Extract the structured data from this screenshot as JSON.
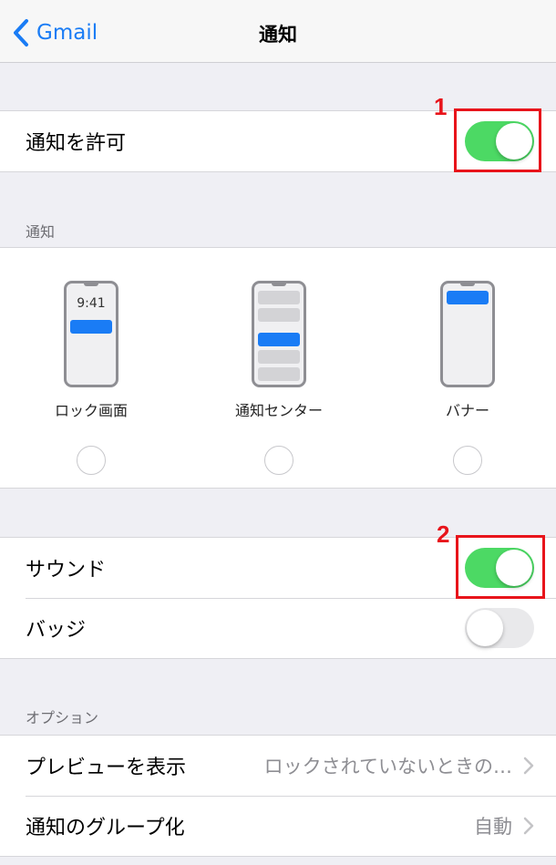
{
  "nav": {
    "back_label": "Gmail",
    "title": "通知"
  },
  "allow": {
    "label": "通知を許可",
    "enabled": true
  },
  "notifications_header": "通知",
  "styles": [
    {
      "label": "ロック画面",
      "time": "9:41"
    },
    {
      "label": "通知センター"
    },
    {
      "label": "バナー"
    }
  ],
  "sound": {
    "label": "サウンド",
    "enabled": true
  },
  "badge": {
    "label": "バッジ",
    "enabled": false
  },
  "options_header": "オプション",
  "options": [
    {
      "label": "プレビューを表示",
      "value": "ロックされていないときの…"
    },
    {
      "label": "通知のグループ化",
      "value": "自動"
    }
  ],
  "annotations": [
    "1",
    "2"
  ],
  "colors": {
    "accent": "#1a7cf5",
    "toggle_on": "#4cd964",
    "annotation": "#e8141b"
  }
}
